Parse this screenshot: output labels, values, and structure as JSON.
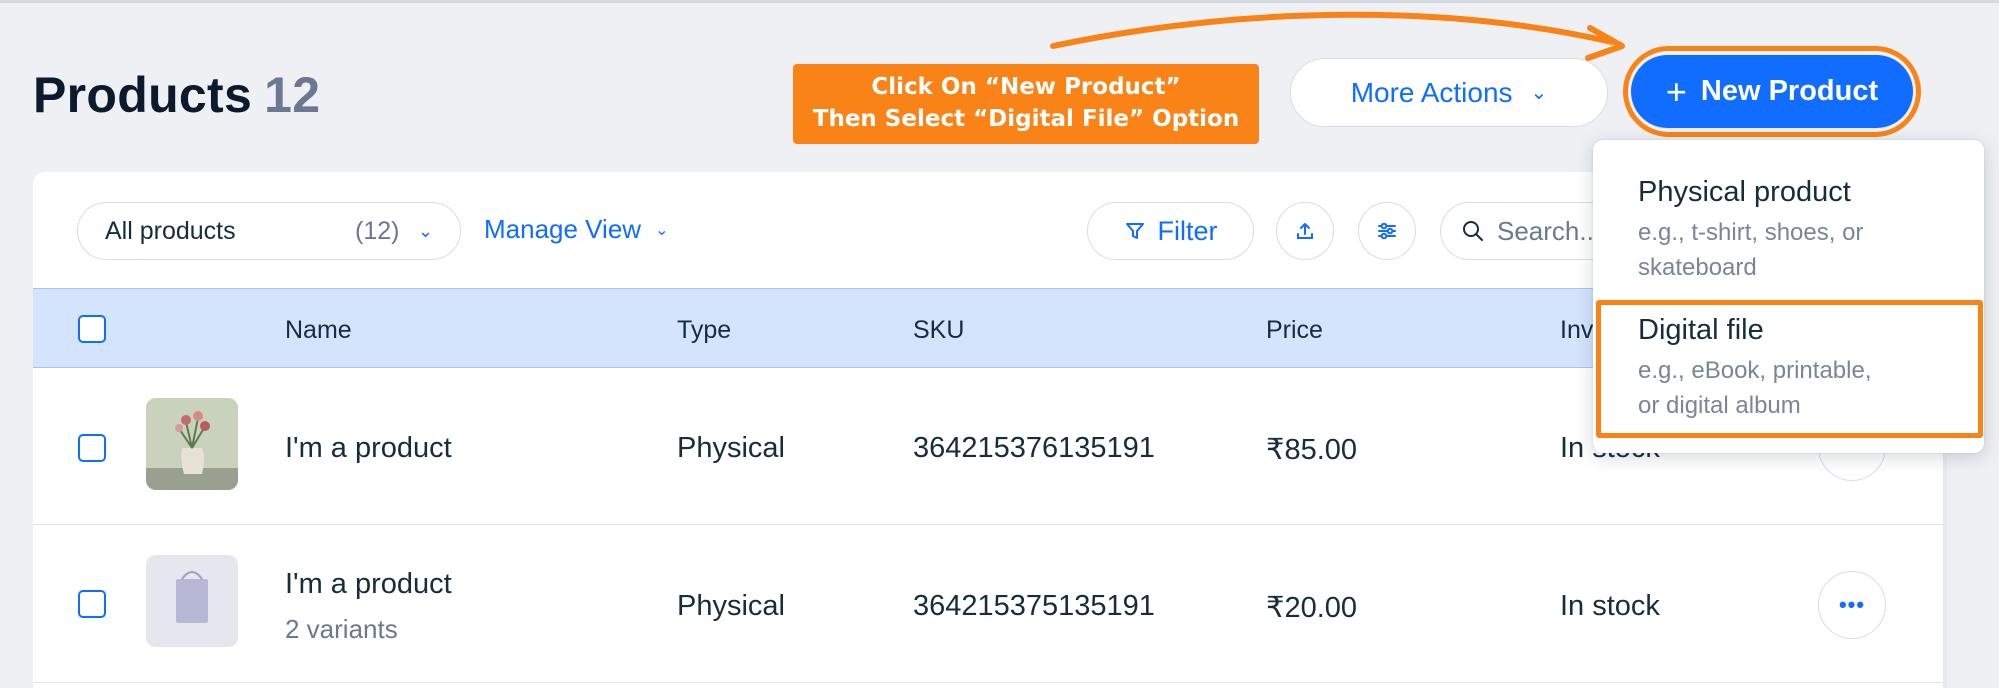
{
  "header": {
    "title": "Products",
    "count": "12"
  },
  "annotation": {
    "line1": "Click On “New Product”",
    "line2": "Then Select “Digital File” Option"
  },
  "actions": {
    "more_label": "More Actions",
    "new_label": "New Product"
  },
  "toolbar": {
    "view_label": "All products",
    "view_count": "(12)",
    "manage_view": "Manage View",
    "filter": "Filter",
    "search_placeholder": "Search..."
  },
  "table": {
    "columns": [
      "Name",
      "Type",
      "SKU",
      "Price",
      "Inventory"
    ],
    "rows": [
      {
        "name": "I'm a product",
        "variants": "",
        "type": "Physical",
        "sku": "364215376135191",
        "price": "₹85.00",
        "inventory": "In stock"
      },
      {
        "name": "I'm a product",
        "variants": "2 variants",
        "type": "Physical",
        "sku": "364215375135191",
        "price": "₹20.00",
        "inventory": "In stock"
      }
    ]
  },
  "new_product_menu": [
    {
      "title": "Physical product",
      "desc1": "e.g., t-shirt, shoes, or",
      "desc2": "skateboard"
    },
    {
      "title": "Digital file",
      "desc1": "e.g., eBook, printable,",
      "desc2": "or digital album"
    }
  ],
  "colors": {
    "accent": "#116dff",
    "annotation": "#f98316",
    "header_row": "#d4e4fd"
  }
}
